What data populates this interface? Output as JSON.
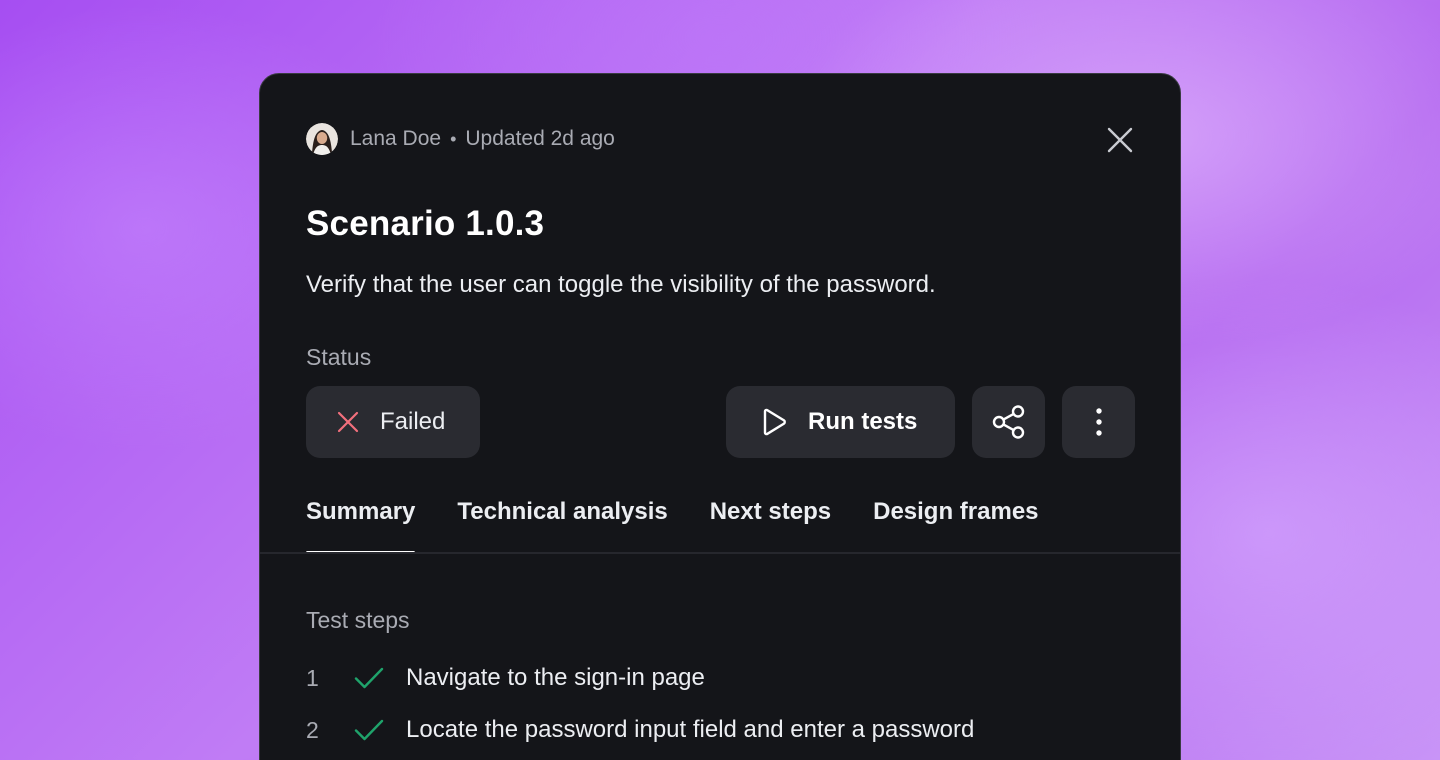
{
  "header": {
    "author": "Lana Doe",
    "separator": "•",
    "updated": "Updated 2d ago"
  },
  "scenario": {
    "title": "Scenario 1.0.3",
    "description": "Verify that the user can toggle the visibility of the password."
  },
  "status": {
    "label": "Status",
    "value": "Failed",
    "icon": "x-icon",
    "color": "#f2707d"
  },
  "actions": {
    "run_label": "Run tests",
    "run_icon": "play-icon",
    "share_icon": "share-icon",
    "more_icon": "more-vertical-icon"
  },
  "tabs": [
    {
      "label": "Summary",
      "active": true
    },
    {
      "label": "Technical analysis",
      "active": false
    },
    {
      "label": "Next steps",
      "active": false
    },
    {
      "label": "Design frames",
      "active": false
    }
  ],
  "test_steps": {
    "label": "Test steps",
    "check_color": "#1fa36b",
    "items": [
      {
        "num": "1",
        "text": "Navigate to the sign-in page",
        "status": "passed"
      },
      {
        "num": "2",
        "text": "Locate the password input field and enter a password",
        "status": "passed"
      }
    ]
  }
}
